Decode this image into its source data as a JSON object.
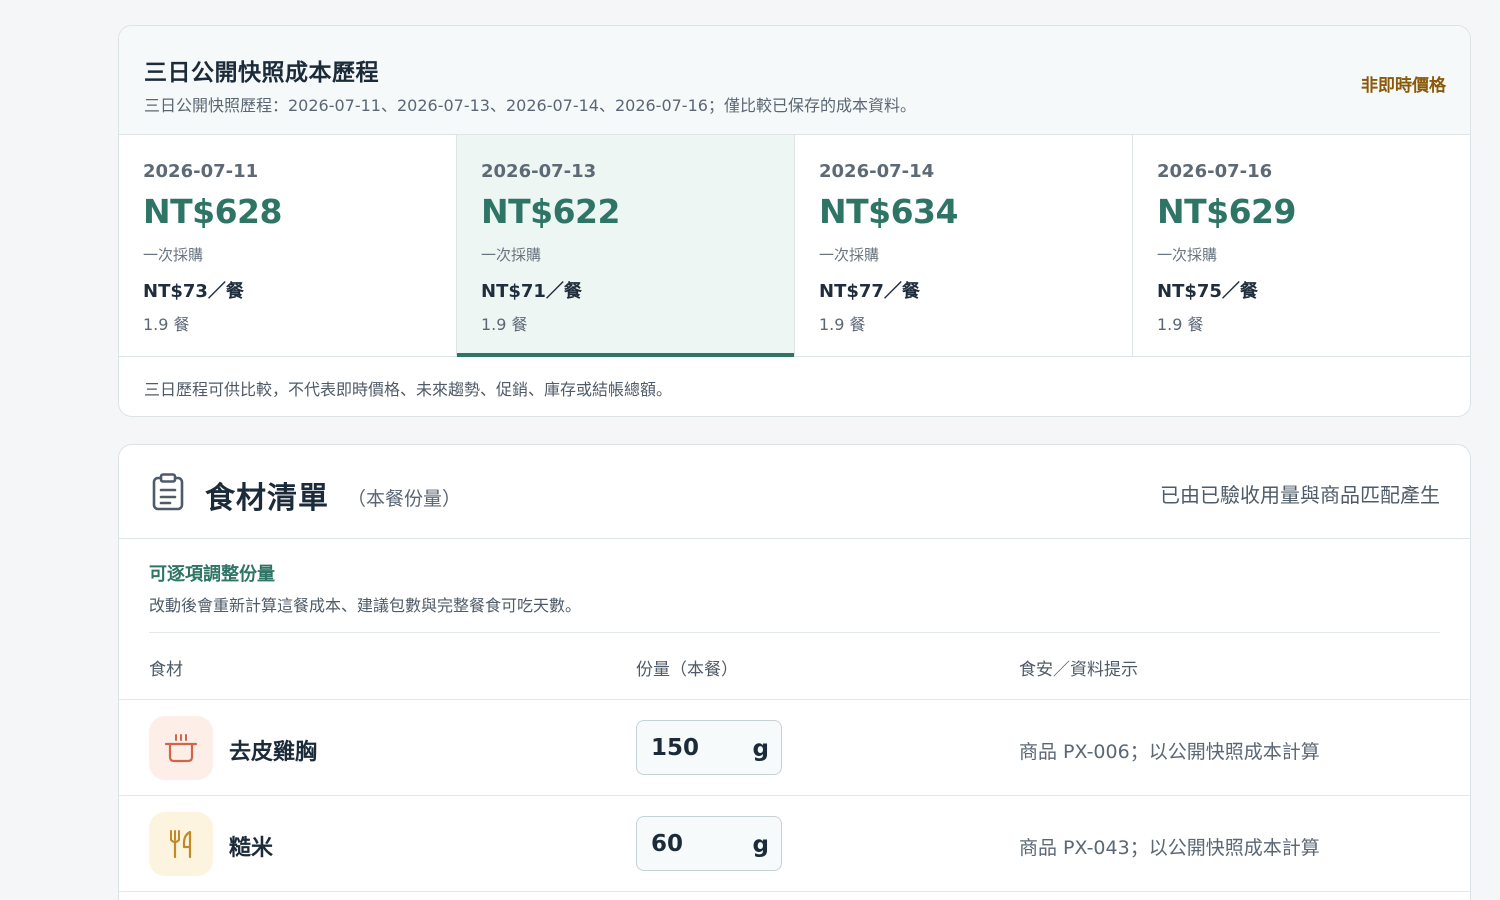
{
  "history": {
    "title": "三日公開快照成本歷程",
    "subtitle": "三日公開快照歷程：2026-07-11、2026-07-13、2026-07-14、2026-07-16；僅比較已保存的成本資料。",
    "badge": "非即時價格",
    "snapshots": [
      {
        "date": "2026-07-11",
        "total": "NT$628",
        "mode": "一次採購",
        "per_meal": "NT$73／餐",
        "meals": "1.9 餐",
        "selected": false
      },
      {
        "date": "2026-07-13",
        "total": "NT$622",
        "mode": "一次採購",
        "per_meal": "NT$71／餐",
        "meals": "1.9 餐",
        "selected": true
      },
      {
        "date": "2026-07-14",
        "total": "NT$634",
        "mode": "一次採購",
        "per_meal": "NT$77／餐",
        "meals": "1.9 餐",
        "selected": false
      },
      {
        "date": "2026-07-16",
        "total": "NT$629",
        "mode": "一次採購",
        "per_meal": "NT$75／餐",
        "meals": "1.9 餐",
        "selected": false
      }
    ],
    "note": "三日歷程可供比較，不代表即時價格、未來趨勢、促銷、庫存或結帳總額。"
  },
  "ingredients": {
    "title": "食材清單",
    "title_note": "（本餐份量）",
    "source": "已由已驗收用量與商品匹配產生",
    "adjust_title": "可逐項調整份量",
    "adjust_desc": "改動後會重新計算這餐成本、建議包數與完整餐食可吃天數。",
    "columns": {
      "ingredient": "食材",
      "quantity": "份量（本餐）",
      "note": "食安／資料提示"
    },
    "rows": [
      {
        "icon": "pot-icon",
        "name": "去皮雞胸",
        "qty": "150",
        "unit": "g",
        "note": "商品 PX-006；以公開快照成本計算"
      },
      {
        "icon": "utensils-icon",
        "name": "糙米",
        "qty": "60",
        "unit": "g",
        "note": "商品 PX-043；以公開快照成本計算"
      }
    ]
  },
  "colors": {
    "accent": "#2f7566",
    "warning": "#8a5a0a",
    "pot_icon": "#d0654a",
    "utensils_icon": "#c08a28"
  }
}
